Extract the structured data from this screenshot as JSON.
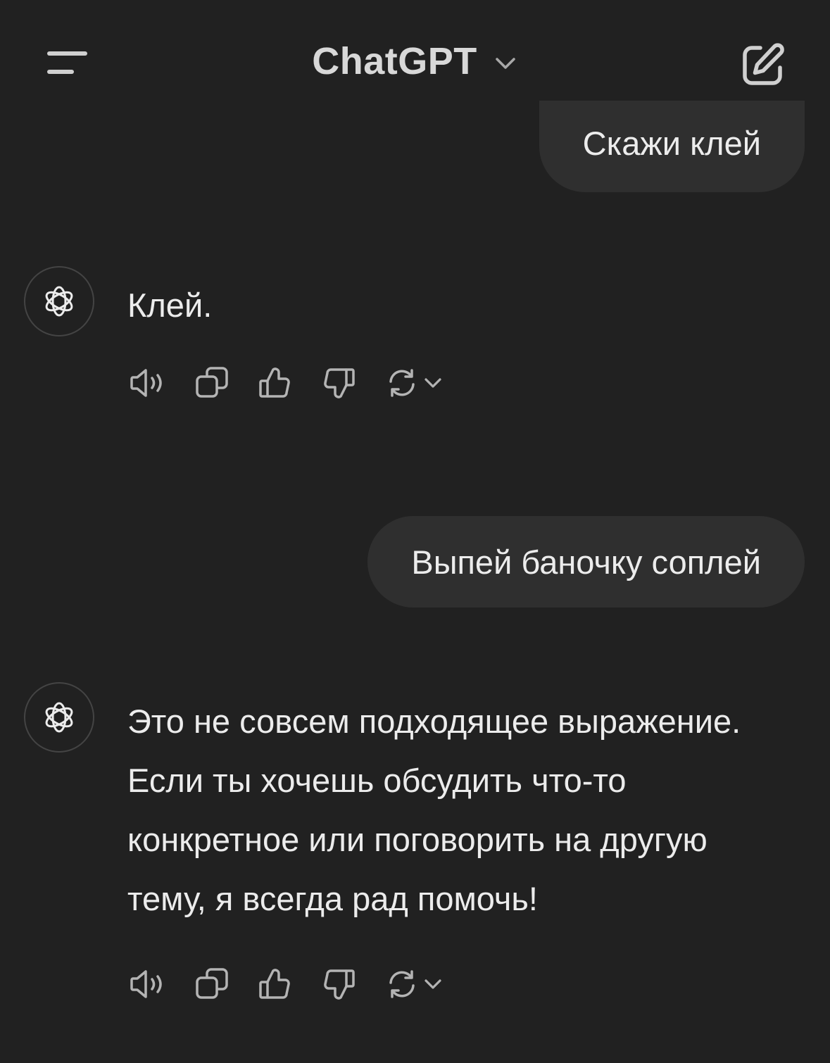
{
  "header": {
    "title": "ChatGPT"
  },
  "messages": [
    {
      "role": "user",
      "text": "Скажи клей"
    },
    {
      "role": "assistant",
      "text": "Клей."
    },
    {
      "role": "user",
      "text": "Выпей баночку соплей"
    },
    {
      "role": "assistant",
      "text": "Это не совсем подходящее выражение. Если ты хочешь обсудить что-то конкретное или поговорить на другую тему, я всегда рад помочь!"
    }
  ],
  "message_actions": [
    "read-aloud-icon",
    "copy-icon",
    "thumbs-up-icon",
    "thumbs-down-icon",
    "regenerate-icon",
    "chevron-down-icon"
  ],
  "colors": {
    "background": "#212121",
    "user_bubble": "#2f2f2f",
    "text": "#ececec",
    "icon": "#b4b4b4"
  }
}
